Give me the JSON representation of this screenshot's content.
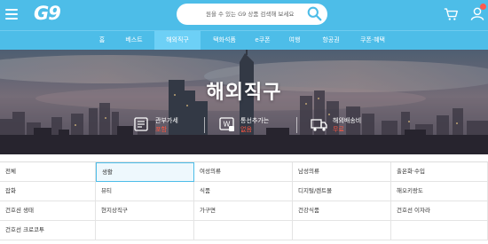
{
  "header": {
    "logo": "G9",
    "search_placeholder": "원을 수 있는 G9 상품 검색해 보세요"
  },
  "nav": {
    "items": [
      {
        "label": "홈"
      },
      {
        "label": "베스트"
      },
      {
        "label": "해외직구",
        "active": true
      },
      {
        "label": "택화석품"
      },
      {
        "label": "e쿠폰"
      },
      {
        "label": "여행"
      },
      {
        "label": "항공권"
      },
      {
        "label": "쿠폰·혜택"
      }
    ]
  },
  "hero": {
    "title": "해외직구",
    "badges": [
      {
        "label": "관부가세",
        "value": "포함"
      },
      {
        "label": "통선추가는",
        "value": "없음"
      },
      {
        "label": "해외배송비",
        "value": "무료"
      }
    ]
  },
  "categories": {
    "rows": [
      [
        "전체",
        "생활",
        "여성의류",
        "남성의류",
        "출온화·수입"
      ],
      [
        "잡화",
        "뷰티",
        "식품",
        "디지털/렌트몰",
        "해오키랑도"
      ],
      [
        "건호션 생태",
        "현지상직구",
        "가구면",
        "건강식품",
        "건호선 이자라"
      ],
      [
        "건호선 크로코투",
        "",
        "",
        "",
        ""
      ]
    ]
  },
  "colors": {
    "brand": "#4dbde8",
    "active_tab": "#6dd0f6",
    "accent_red": "#ff5540"
  }
}
